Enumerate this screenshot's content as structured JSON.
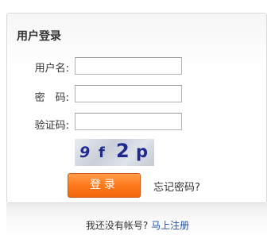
{
  "panel": {
    "title": "用户登录"
  },
  "form": {
    "username_label": "用户名:",
    "username_value": "",
    "password_label": "密　码:",
    "password_value": "",
    "captcha_label": "验证码:",
    "captcha_value": ""
  },
  "captcha_image": {
    "chars": [
      "9",
      "f",
      "2",
      "p"
    ]
  },
  "actions": {
    "login_label": "登录",
    "forgot_label": "忘记密码?"
  },
  "footer": {
    "no_account_text": "我还没有帐号?",
    "register_label": "马上注册"
  },
  "colors": {
    "button_orange": "#ff7a1c",
    "link_blue": "#1f4f9c",
    "captcha_text": "#1f2a8c"
  }
}
